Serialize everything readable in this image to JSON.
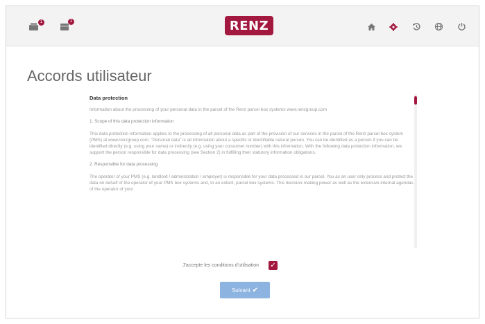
{
  "header": {
    "left_icons": [
      {
        "name": "inbox-icon",
        "badge": "1"
      },
      {
        "name": "mailbox-icon",
        "badge": "1"
      }
    ],
    "logo_text": "RENZ",
    "right_icons": [
      "home-icon",
      "settings-icon",
      "history-icon",
      "language-icon",
      "power-icon"
    ]
  },
  "page": {
    "title": "Accords utilisateur"
  },
  "document": {
    "heading": "Data protection",
    "intro": "Information about the processing of your personal data in the parcel of the Renz parcel box systems www.renzgroup.com",
    "sections": [
      {
        "title": "1. Scope of this data protection information",
        "body": "This data protection information applies to the processing of all personal data as part of the provision of our services in the parcel of the Renz parcel box system (PMS) at www.renzgroup.com. \"Personal data\" is all information about a specific or identifiable natural person. You can be identified as a person if you can be identified directly (e.g. using your name) or indirectly (e.g. using your consumer number) with this information. With the following data protection information, we support the person responsible for data processing (see Section 2) in fulfilling their statutory information obligations."
      },
      {
        "title": "2. Responsible for data processing",
        "body": "The operator of your PMS (e.g. landlord / administration / employer) is responsible for your data processed in our parcel. You as an user only process and protect the data on behalf of the operator of your PMS box systems and, to an extent, parcel box systems. This decision-making power as well as the extensive internal agendas of the operator of your"
      }
    ]
  },
  "accept": {
    "label": "J'accepte les conditions d'utilisation",
    "checked": true
  },
  "continue_button": {
    "label": "Suivant"
  },
  "colors": {
    "accent": "#a3183f",
    "button": "#8db3e0",
    "header_bg": "#f3f3f3"
  }
}
